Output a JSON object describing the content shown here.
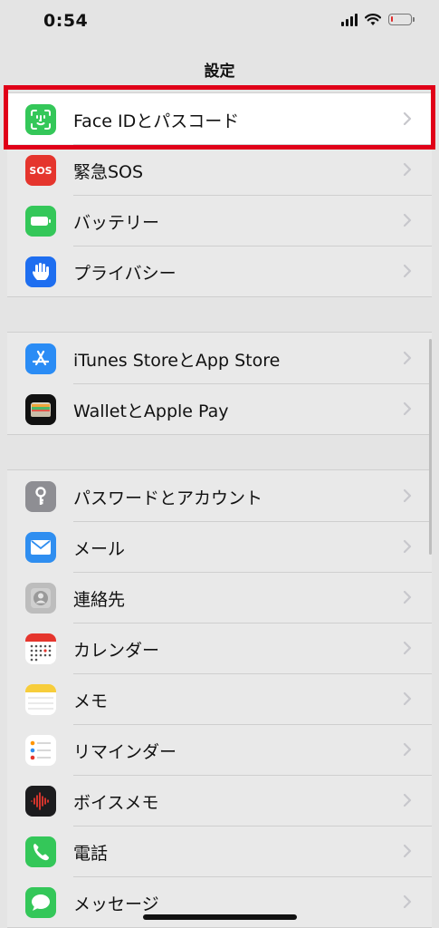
{
  "status_bar": {
    "time": "0:54",
    "battery_level": 0.08,
    "battery_color": "#e02a2a"
  },
  "nav": {
    "title": "設定"
  },
  "groups": [
    {
      "items": [
        {
          "label": "Face IDとパスコード",
          "icon": "face-id-icon",
          "color": "#34c759",
          "highlighted": true
        },
        {
          "label": "緊急SOS",
          "icon": "sos-icon",
          "icon_text": "SOS",
          "color": "#e5352d"
        },
        {
          "label": "バッテリー",
          "icon": "battery-icon",
          "color": "#34c759"
        },
        {
          "label": "プライバシー",
          "icon": "hand-icon",
          "color": "#1e6ef0"
        }
      ]
    },
    {
      "items": [
        {
          "label": "iTunes StoreとApp Store",
          "icon": "app-store-icon",
          "color": "#2a8cf5"
        },
        {
          "label": "WalletとApple Pay",
          "icon": "wallet-icon",
          "color": "#111111"
        }
      ]
    },
    {
      "items": [
        {
          "label": "パスワードとアカウント",
          "icon": "key-icon",
          "color": "#8e8e93"
        },
        {
          "label": "メール",
          "icon": "mail-icon",
          "color": "#2f8ef0"
        },
        {
          "label": "連絡先",
          "icon": "contacts-icon",
          "color": "#b9b9b9"
        },
        {
          "label": "カレンダー",
          "icon": "calendar-icon",
          "color": "#ffffff"
        },
        {
          "label": "メモ",
          "icon": "notes-icon",
          "color": "#ffffff"
        },
        {
          "label": "リマインダー",
          "icon": "reminders-icon",
          "color": "#ffffff"
        },
        {
          "label": "ボイスメモ",
          "icon": "voice-memo-icon",
          "color": "#1c1c1e"
        },
        {
          "label": "電話",
          "icon": "phone-icon",
          "color": "#34c759"
        },
        {
          "label": "メッセージ",
          "icon": "messages-icon",
          "color": "#34c759"
        }
      ]
    }
  ],
  "highlight_color": "#e00018"
}
